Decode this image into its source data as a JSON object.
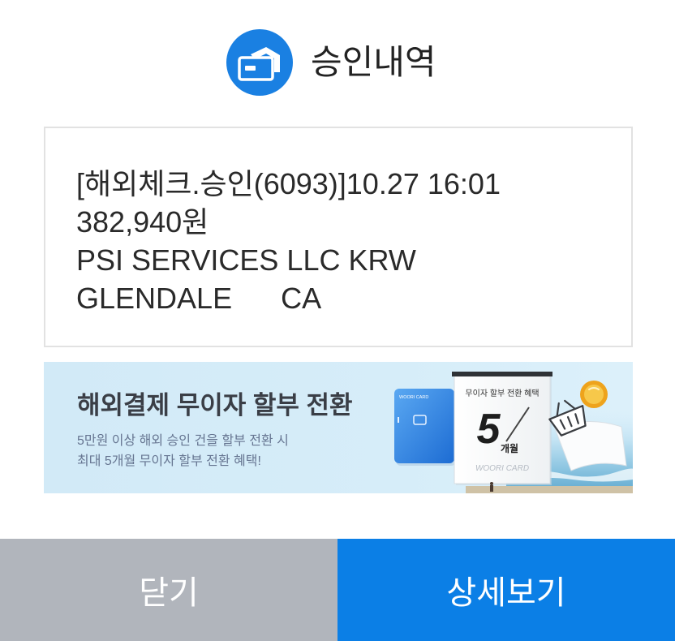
{
  "header": {
    "icon": "card-approval-icon",
    "title": "승인내역"
  },
  "message": {
    "lines": [
      "[해외체크.승인(6093)]10.27 16:01",
      "382,940원",
      "PSI SERVICES LLC KRW",
      "GLENDALE      CA"
    ]
  },
  "banner": {
    "headline": "해외결제 무이자 할부 전환",
    "sub_lines": [
      "5만원 이상 해외 승인 건을 할부 전환 시",
      "최대 5개월 무이자 할부 전환 혜택!"
    ],
    "card": {
      "brand": "WOORI CARD"
    },
    "calendar": {
      "title": "무이자 할부 전환 혜택",
      "number": "5",
      "unit": "개월",
      "brand": "WOORI CARD"
    },
    "icons": [
      "credit-card-icon",
      "calendar-icon",
      "shopping-basket-icon",
      "coin-icon"
    ]
  },
  "buttons": {
    "close_label": "닫기",
    "detail_label": "상세보기"
  },
  "colors": {
    "accent": "#1a80e2",
    "close_button": "#b1b5bc",
    "detail_button": "#0b7fe6",
    "banner_bg": "#d4ebf8"
  }
}
